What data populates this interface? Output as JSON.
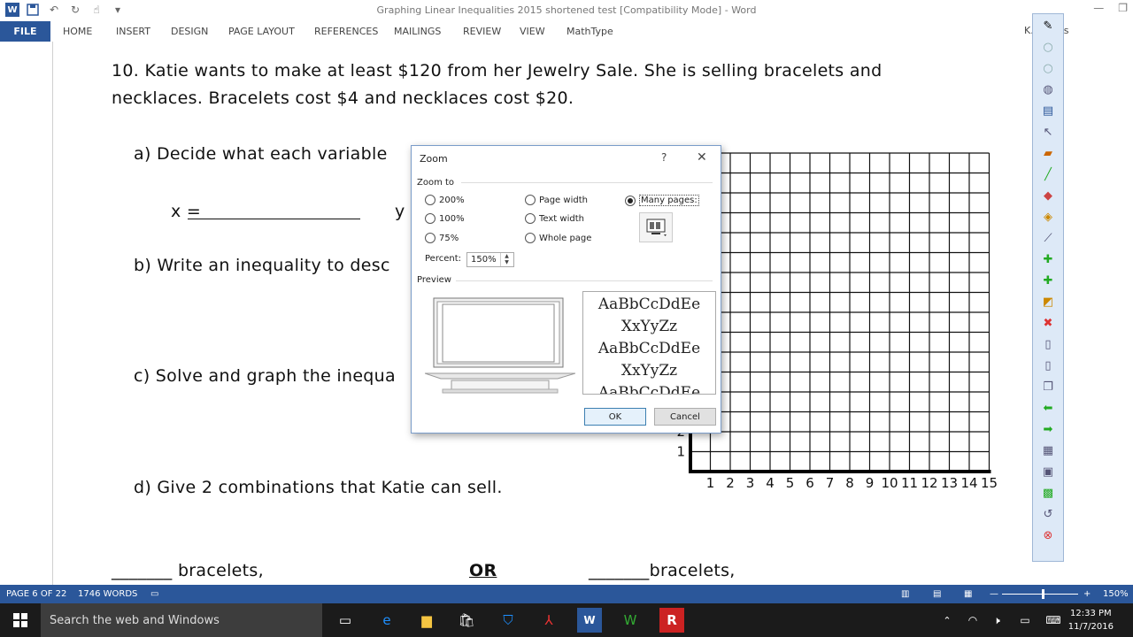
{
  "app": {
    "title": "Graphing Linear Inequalities 2015 shortened test [Compatibility Mode] - Word",
    "user": "K. Collins"
  },
  "ribbon": {
    "file": "FILE",
    "tabs": [
      "HOME",
      "INSERT",
      "DESIGN",
      "PAGE LAYOUT",
      "REFERENCES",
      "MAILINGS",
      "REVIEW",
      "VIEW",
      "MathType"
    ]
  },
  "document": {
    "q10_line1": "10.  Katie wants to make at least $120 from her Jewelry Sale.  She is selling bracelets and",
    "q10_line2": "necklaces.  Bracelets cost $4 and necklaces cost $20.",
    "part_a": "a)  Decide what each variable",
    "x_eq": "x =",
    "y_label": "y",
    "part_b": "b)  Write an inequality to desc",
    "part_c": "c)  Solve and graph the inequa",
    "part_d": "d)  Give 2 combinations that Katie can sell.",
    "bracelets_left": "_______ bracelets,",
    "or": "OR",
    "bracelets_right": "_______bracelets,",
    "grid_x_ticks": [
      "1",
      "2",
      "3",
      "4",
      "5",
      "6",
      "7",
      "8",
      "9",
      "10",
      "11",
      "12",
      "13",
      "14",
      "15"
    ],
    "grid_y_ticks": [
      "1",
      "2"
    ]
  },
  "dialog": {
    "title": "Zoom",
    "help": "?",
    "close": "✕",
    "zoom_to": "Zoom to",
    "options": {
      "z200": "200%",
      "z100": "100%",
      "z75": "75%",
      "page_width": "Page width",
      "text_width": "Text width",
      "whole_page": "Whole page",
      "many_pages": "Many pages:"
    },
    "percent_label": "Percent:",
    "percent_value": "150%",
    "preview_label": "Preview",
    "preview_text": [
      "AaBbCcDdEe",
      "XxYyZz",
      "AaBbCcDdEe",
      "XxYyZz",
      "AaBbCcDdEe"
    ],
    "ok": "OK",
    "cancel": "Cancel"
  },
  "status": {
    "page": "PAGE 6 OF 22",
    "words": "1746 WORDS",
    "zoom": "150%"
  },
  "taskbar": {
    "search": "Search the web and Windows",
    "time": "12:33 PM",
    "date": "11/7/2016"
  },
  "colors": {
    "word_blue": "#2b579a",
    "taskbar": "#1b1b1b"
  }
}
